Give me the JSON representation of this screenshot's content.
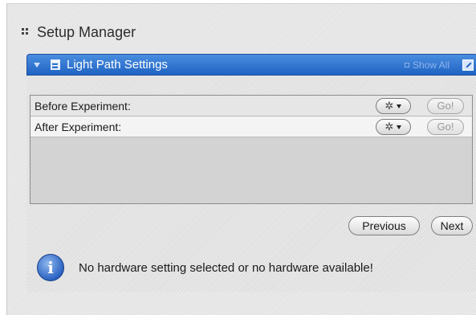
{
  "setup": {
    "title": "Setup Manager"
  },
  "panel": {
    "title": "Light Path Settings",
    "show_all": "Show All"
  },
  "rows": [
    {
      "label": "Before Experiment:",
      "go": "Go!"
    },
    {
      "label": "After Experiment:",
      "go": "Go!"
    }
  ],
  "nav": {
    "previous": "Previous",
    "next": "Next"
  },
  "message": {
    "icon": "info-icon",
    "text": "No hardware setting selected or no hardware available!"
  },
  "colors": {
    "titlebar": "#1f63c3",
    "info": "#2b63c2"
  }
}
